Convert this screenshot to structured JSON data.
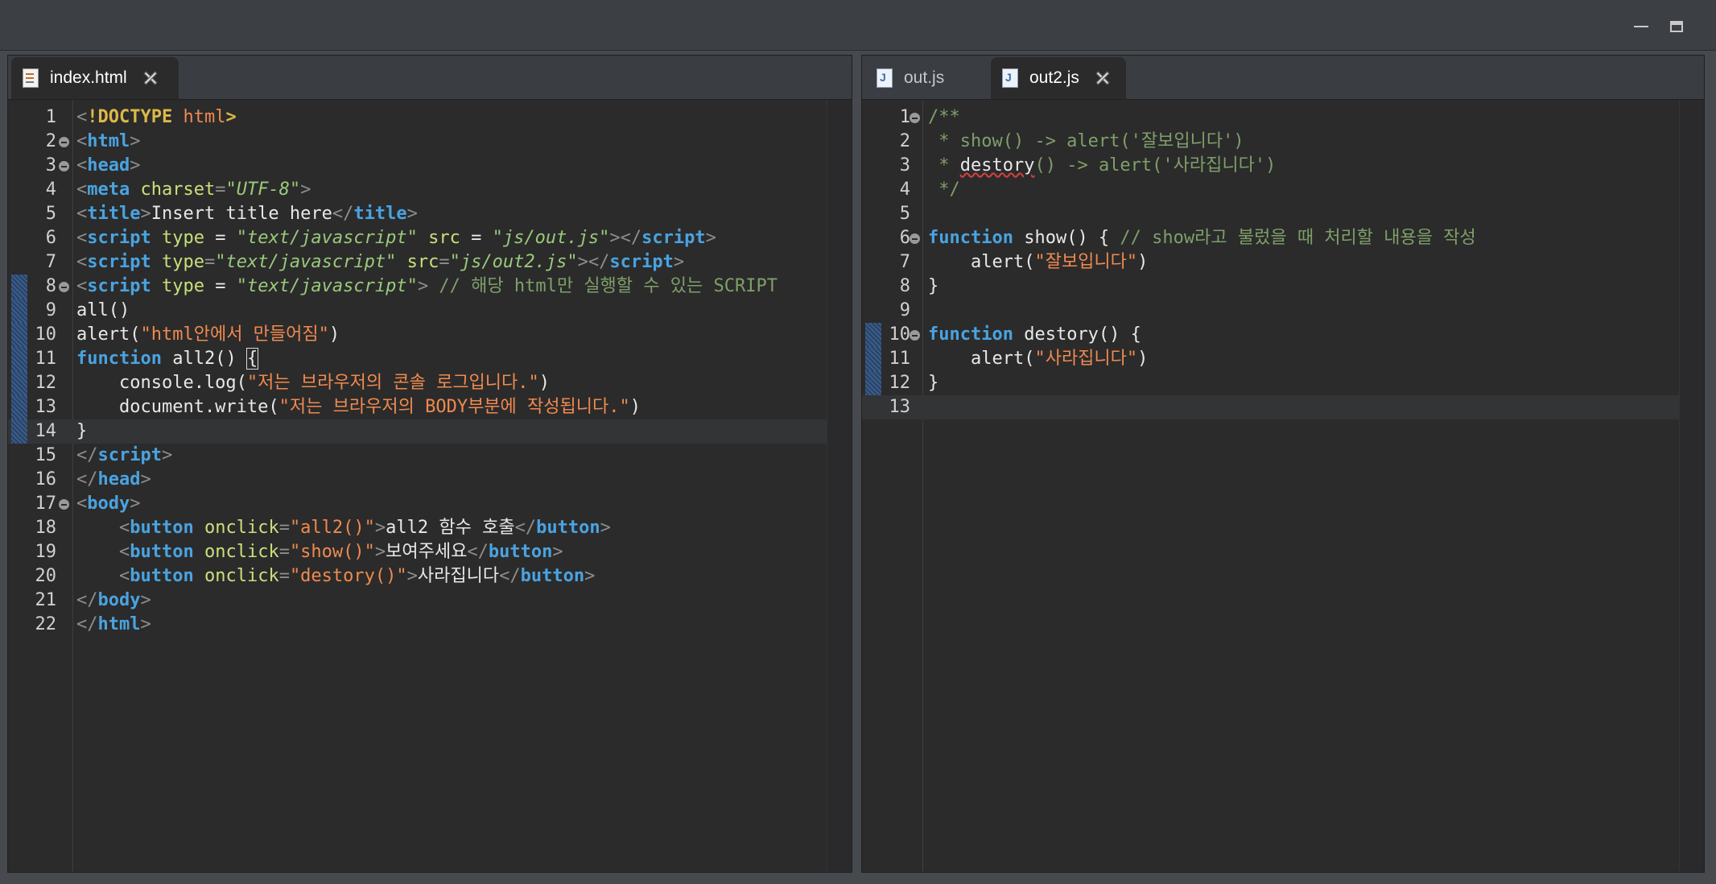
{
  "window": {
    "minimize_label": "",
    "maximize_label": ""
  },
  "colors": {
    "background": "#2b2b2b",
    "tag": "#4aa3e0",
    "attribute": "#c8e07a",
    "string": "#f08a4f",
    "comment": "#7f9f6a"
  },
  "left_pane": {
    "tabs": [
      {
        "label": "index.html",
        "icon": "html-file-icon",
        "active": true
      }
    ],
    "lines": [
      {
        "n": "1",
        "tokens": [
          [
            "br",
            "<"
          ],
          [
            "dt",
            "!DOCTYPE"
          ],
          [
            "pl",
            " "
          ],
          [
            "st",
            "html"
          ],
          [
            "dt",
            ">"
          ]
        ]
      },
      {
        "n": "2",
        "fold": true,
        "tokens": [
          [
            "br",
            "<"
          ],
          [
            "tg",
            "html"
          ],
          [
            "br",
            ">"
          ]
        ]
      },
      {
        "n": "3",
        "fold": true,
        "tokens": [
          [
            "br",
            "<"
          ],
          [
            "tg",
            "head"
          ],
          [
            "br",
            ">"
          ]
        ]
      },
      {
        "n": "4",
        "tokens": [
          [
            "br",
            "<"
          ],
          [
            "tg",
            "meta"
          ],
          [
            "pl",
            " "
          ],
          [
            "at",
            "charset"
          ],
          [
            "br",
            "="
          ],
          [
            "sti",
            "\"UTF-8\""
          ],
          [
            "br",
            ">"
          ]
        ]
      },
      {
        "n": "5",
        "tokens": [
          [
            "br",
            "<"
          ],
          [
            "tg",
            "title"
          ],
          [
            "br",
            ">"
          ],
          [
            "pl",
            "Insert title here"
          ],
          [
            "br",
            "</"
          ],
          [
            "tg",
            "title"
          ],
          [
            "br",
            ">"
          ]
        ]
      },
      {
        "n": "6",
        "tokens": [
          [
            "br",
            "<"
          ],
          [
            "tg",
            "script"
          ],
          [
            "pl",
            " "
          ],
          [
            "at",
            "type"
          ],
          [
            "pl",
            " = "
          ],
          [
            "sti",
            "\"text/javascript\""
          ],
          [
            "pl",
            " "
          ],
          [
            "at",
            "src"
          ],
          [
            "pl",
            " = "
          ],
          [
            "sti",
            "\"js/out.js\""
          ],
          [
            "br",
            "></"
          ],
          [
            "tg",
            "script"
          ],
          [
            "br",
            ">"
          ]
        ]
      },
      {
        "n": "7",
        "tokens": [
          [
            "br",
            "<"
          ],
          [
            "tg",
            "script"
          ],
          [
            "pl",
            " "
          ],
          [
            "at",
            "type"
          ],
          [
            "br",
            "="
          ],
          [
            "sti",
            "\"text/javascript\""
          ],
          [
            "pl",
            " "
          ],
          [
            "at",
            "src"
          ],
          [
            "br",
            "="
          ],
          [
            "sti",
            "\"js/out2.js\""
          ],
          [
            "br",
            "></"
          ],
          [
            "tg",
            "script"
          ],
          [
            "br",
            ">"
          ]
        ]
      },
      {
        "n": "8",
        "fold": true,
        "mark": true,
        "tokens": [
          [
            "br",
            "<"
          ],
          [
            "tg",
            "script"
          ],
          [
            "pl",
            " "
          ],
          [
            "at",
            "type"
          ],
          [
            "pl",
            " = "
          ],
          [
            "sti",
            "\"text/javascript\""
          ],
          [
            "br",
            ">"
          ],
          [
            "pl",
            " "
          ],
          [
            "cm",
            "// 해당 html만 실행할 수 있는 SCRIPT"
          ]
        ]
      },
      {
        "n": "9",
        "mark": true,
        "tokens": [
          [
            "pl",
            "all()"
          ]
        ]
      },
      {
        "n": "10",
        "mark": true,
        "tokens": [
          [
            "pl",
            "alert("
          ],
          [
            "st",
            "\"html안에서 만들어짐\""
          ],
          [
            "pl",
            ")"
          ]
        ]
      },
      {
        "n": "11",
        "mark": true,
        "tokens": [
          [
            "kw",
            "function"
          ],
          [
            "pl",
            " all2() "
          ],
          [
            "caret",
            "{"
          ]
        ]
      },
      {
        "n": "12",
        "mark": true,
        "tokens": [
          [
            "pl",
            "    console.log("
          ],
          [
            "st",
            "\"저는 브라우저의 콘솔 로그입니다.\""
          ],
          [
            "pl",
            ")"
          ]
        ]
      },
      {
        "n": "13",
        "mark": true,
        "tokens": [
          [
            "pl",
            "    document.write("
          ],
          [
            "st",
            "\"저는 브라우저의 BODY부분에 작성됩니다.\""
          ],
          [
            "pl",
            ")"
          ]
        ]
      },
      {
        "n": "14",
        "mark": true,
        "cur": true,
        "tokens": [
          [
            "pl",
            "}"
          ]
        ]
      },
      {
        "n": "15",
        "tokens": [
          [
            "br",
            "</"
          ],
          [
            "tg",
            "script"
          ],
          [
            "br",
            ">"
          ]
        ]
      },
      {
        "n": "16",
        "tokens": [
          [
            "br",
            "</"
          ],
          [
            "tg",
            "head"
          ],
          [
            "br",
            ">"
          ]
        ]
      },
      {
        "n": "17",
        "fold": true,
        "tokens": [
          [
            "br",
            "<"
          ],
          [
            "tg",
            "body"
          ],
          [
            "br",
            ">"
          ]
        ]
      },
      {
        "n": "18",
        "tokens": [
          [
            "pl",
            "    "
          ],
          [
            "br",
            "<"
          ],
          [
            "tg",
            "button"
          ],
          [
            "pl",
            " "
          ],
          [
            "at",
            "onclick"
          ],
          [
            "br",
            "="
          ],
          [
            "st",
            "\"all2()\""
          ],
          [
            "br",
            ">"
          ],
          [
            "pl",
            "all2 함수 호출"
          ],
          [
            "br",
            "</"
          ],
          [
            "tg",
            "button"
          ],
          [
            "br",
            ">"
          ]
        ]
      },
      {
        "n": "19",
        "tokens": [
          [
            "pl",
            "    "
          ],
          [
            "br",
            "<"
          ],
          [
            "tg",
            "button"
          ],
          [
            "pl",
            " "
          ],
          [
            "at",
            "onclick"
          ],
          [
            "br",
            "="
          ],
          [
            "st",
            "\"show()\""
          ],
          [
            "br",
            ">"
          ],
          [
            "pl",
            "보여주세요"
          ],
          [
            "br",
            "</"
          ],
          [
            "tg",
            "button"
          ],
          [
            "br",
            ">"
          ]
        ]
      },
      {
        "n": "20",
        "tokens": [
          [
            "pl",
            "    "
          ],
          [
            "br",
            "<"
          ],
          [
            "tg",
            "button"
          ],
          [
            "pl",
            " "
          ],
          [
            "at",
            "onclick"
          ],
          [
            "br",
            "="
          ],
          [
            "st",
            "\"destory()\""
          ],
          [
            "br",
            ">"
          ],
          [
            "pl",
            "사라집니다"
          ],
          [
            "br",
            "</"
          ],
          [
            "tg",
            "button"
          ],
          [
            "br",
            ">"
          ]
        ]
      },
      {
        "n": "21",
        "tokens": [
          [
            "br",
            "</"
          ],
          [
            "tg",
            "body"
          ],
          [
            "br",
            ">"
          ]
        ]
      },
      {
        "n": "22",
        "tokens": [
          [
            "br",
            "</"
          ],
          [
            "tg",
            "html"
          ],
          [
            "br",
            ">"
          ]
        ]
      }
    ]
  },
  "right_pane": {
    "tabs": [
      {
        "label": "out.js",
        "icon": "js-file-icon",
        "active": false
      },
      {
        "label": "out2.js",
        "icon": "js-file-icon",
        "active": true
      }
    ],
    "lines": [
      {
        "n": "1",
        "fold": true,
        "tokens": [
          [
            "cm",
            "/**"
          ]
        ]
      },
      {
        "n": "2",
        "tokens": [
          [
            "cm",
            " * show() -> alert('잘보입니다')"
          ]
        ]
      },
      {
        "n": "3",
        "tokens": [
          [
            "cm",
            " * "
          ],
          [
            "sq",
            "destory"
          ],
          [
            "cm",
            "() -> alert('사라집니다')"
          ]
        ]
      },
      {
        "n": "4",
        "tokens": [
          [
            "cm",
            " */"
          ]
        ]
      },
      {
        "n": "5",
        "tokens": []
      },
      {
        "n": "6",
        "fold": true,
        "tokens": [
          [
            "kw",
            "function"
          ],
          [
            "pl",
            " show() { "
          ],
          [
            "cm",
            "// show라고 불렀을 때 처리할 내용을 작성"
          ]
        ]
      },
      {
        "n": "7",
        "tokens": [
          [
            "pl",
            "    alert("
          ],
          [
            "st",
            "\"잘보입니다\""
          ],
          [
            "pl",
            ")"
          ]
        ]
      },
      {
        "n": "8",
        "tokens": [
          [
            "pl",
            "}"
          ]
        ]
      },
      {
        "n": "9",
        "tokens": []
      },
      {
        "n": "10",
        "fold": true,
        "mark": true,
        "tokens": [
          [
            "kw",
            "function"
          ],
          [
            "pl",
            " destory() {"
          ]
        ]
      },
      {
        "n": "11",
        "mark": true,
        "tokens": [
          [
            "pl",
            "    alert("
          ],
          [
            "st",
            "\"사라집니다\""
          ],
          [
            "pl",
            ")"
          ]
        ]
      },
      {
        "n": "12",
        "mark": true,
        "tokens": [
          [
            "pl",
            "}"
          ]
        ]
      },
      {
        "n": "13",
        "cur": true,
        "tokens": []
      }
    ]
  }
}
